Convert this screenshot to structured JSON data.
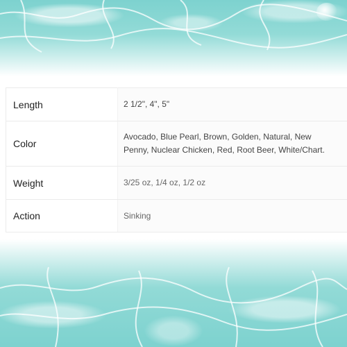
{
  "specs": {
    "rows": [
      {
        "label": "Length",
        "value": "2 1/2\", 4\", 5\""
      },
      {
        "label": "Color",
        "value": "Avocado, Blue Pearl, Brown, Golden, Natural, New Penny, Nuclear Chicken, Red, Root Beer, White/Chart."
      },
      {
        "label": "Weight",
        "value": "3/25 oz, 1/4 oz, 1/2 oz"
      },
      {
        "label": "Action",
        "value": "Sinking"
      }
    ]
  },
  "colors": {
    "water": "#7dd2cf",
    "table_border": "#ebebeb",
    "label_text": "#222222",
    "value_text": "#444444"
  }
}
